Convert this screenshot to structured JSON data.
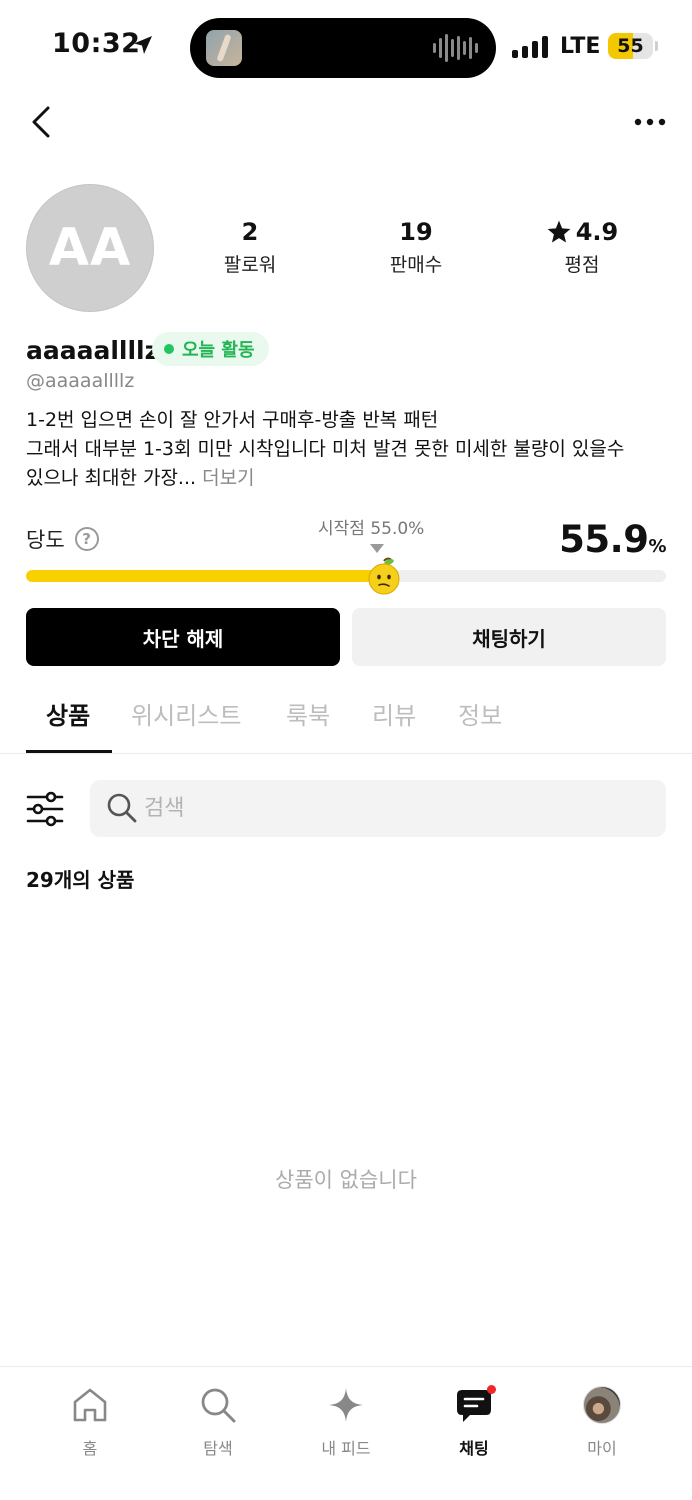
{
  "status_bar": {
    "time": "10:32",
    "network": "LTE",
    "battery": "55",
    "battery_level": 0.55
  },
  "profile": {
    "avatar_initials": "AA",
    "username": "aaaaallllz",
    "active_badge": "오늘 활동",
    "handle": "@aaaaallllz",
    "bio_line1": "1-2번 입으면 손이 잘 안가서 구매후-방출 반복 패턴",
    "bio_line2": "그래서 대부분 1-3회 미만 시착입니다 미처 발견 못한 미세한 불량이 있을수",
    "bio_line3": "있으나 최대한 가장...",
    "bio_more": "더보기",
    "stats": [
      {
        "value": "2",
        "label": "팔로워"
      },
      {
        "value": "19",
        "label": "판매수"
      },
      {
        "value": "4.9",
        "label": "평점",
        "icon": "star-icon"
      }
    ]
  },
  "sweetness": {
    "label": "당도",
    "help": "?",
    "start_point": "시작점 55.0%",
    "start_fraction": 0.55,
    "value": "55.9",
    "unit": "%",
    "fraction": 0.559
  },
  "actions": {
    "unblock": "차단 해제",
    "chat": "채팅하기"
  },
  "tabs": [
    "상품",
    "위시리스트",
    "룩북",
    "리뷰",
    "정보"
  ],
  "search": {
    "placeholder": "검색"
  },
  "products": {
    "count_number": "29",
    "count_suffix": "개의 상품",
    "empty_text": "상품이 없습니다"
  },
  "bottom_nav": [
    {
      "label": "홈",
      "icon": "home-icon"
    },
    {
      "label": "탐색",
      "icon": "search-icon"
    },
    {
      "label": "내 피드",
      "icon": "sparkle-icon"
    },
    {
      "label": "채팅",
      "icon": "chat-icon",
      "active": true
    },
    {
      "label": "마이",
      "icon": "profile-avatar"
    }
  ],
  "colors": {
    "accent_yellow": "#f9d000",
    "active_green": "#22c55e",
    "notification_red": "#f02828"
  }
}
